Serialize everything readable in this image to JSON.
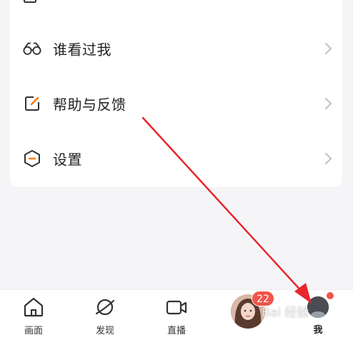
{
  "menu": {
    "items": [
      {
        "label": "谁看过我",
        "icon": "glasses-icon"
      },
      {
        "label": "帮助与反馈",
        "icon": "edit-feedback-icon"
      },
      {
        "label": "设置",
        "icon": "settings-hexagon-icon"
      }
    ]
  },
  "tabbar": {
    "tabs": [
      {
        "label": "画面",
        "icon": "home-icon"
      },
      {
        "label": "发现",
        "icon": "planet-icon"
      },
      {
        "label": "直播",
        "icon": "video-camera-icon"
      },
      {
        "label": "",
        "icon": "live-avatar"
      },
      {
        "label": "我",
        "icon": "profile-avatar",
        "active": true
      }
    ],
    "live_badge_count": "22"
  },
  "watermark": {
    "text": "Bai 经验"
  },
  "colors": {
    "accent": "#f0554b",
    "annotation_arrow": "#e8262b",
    "background": "#f5f5f7",
    "card": "#ffffff"
  }
}
